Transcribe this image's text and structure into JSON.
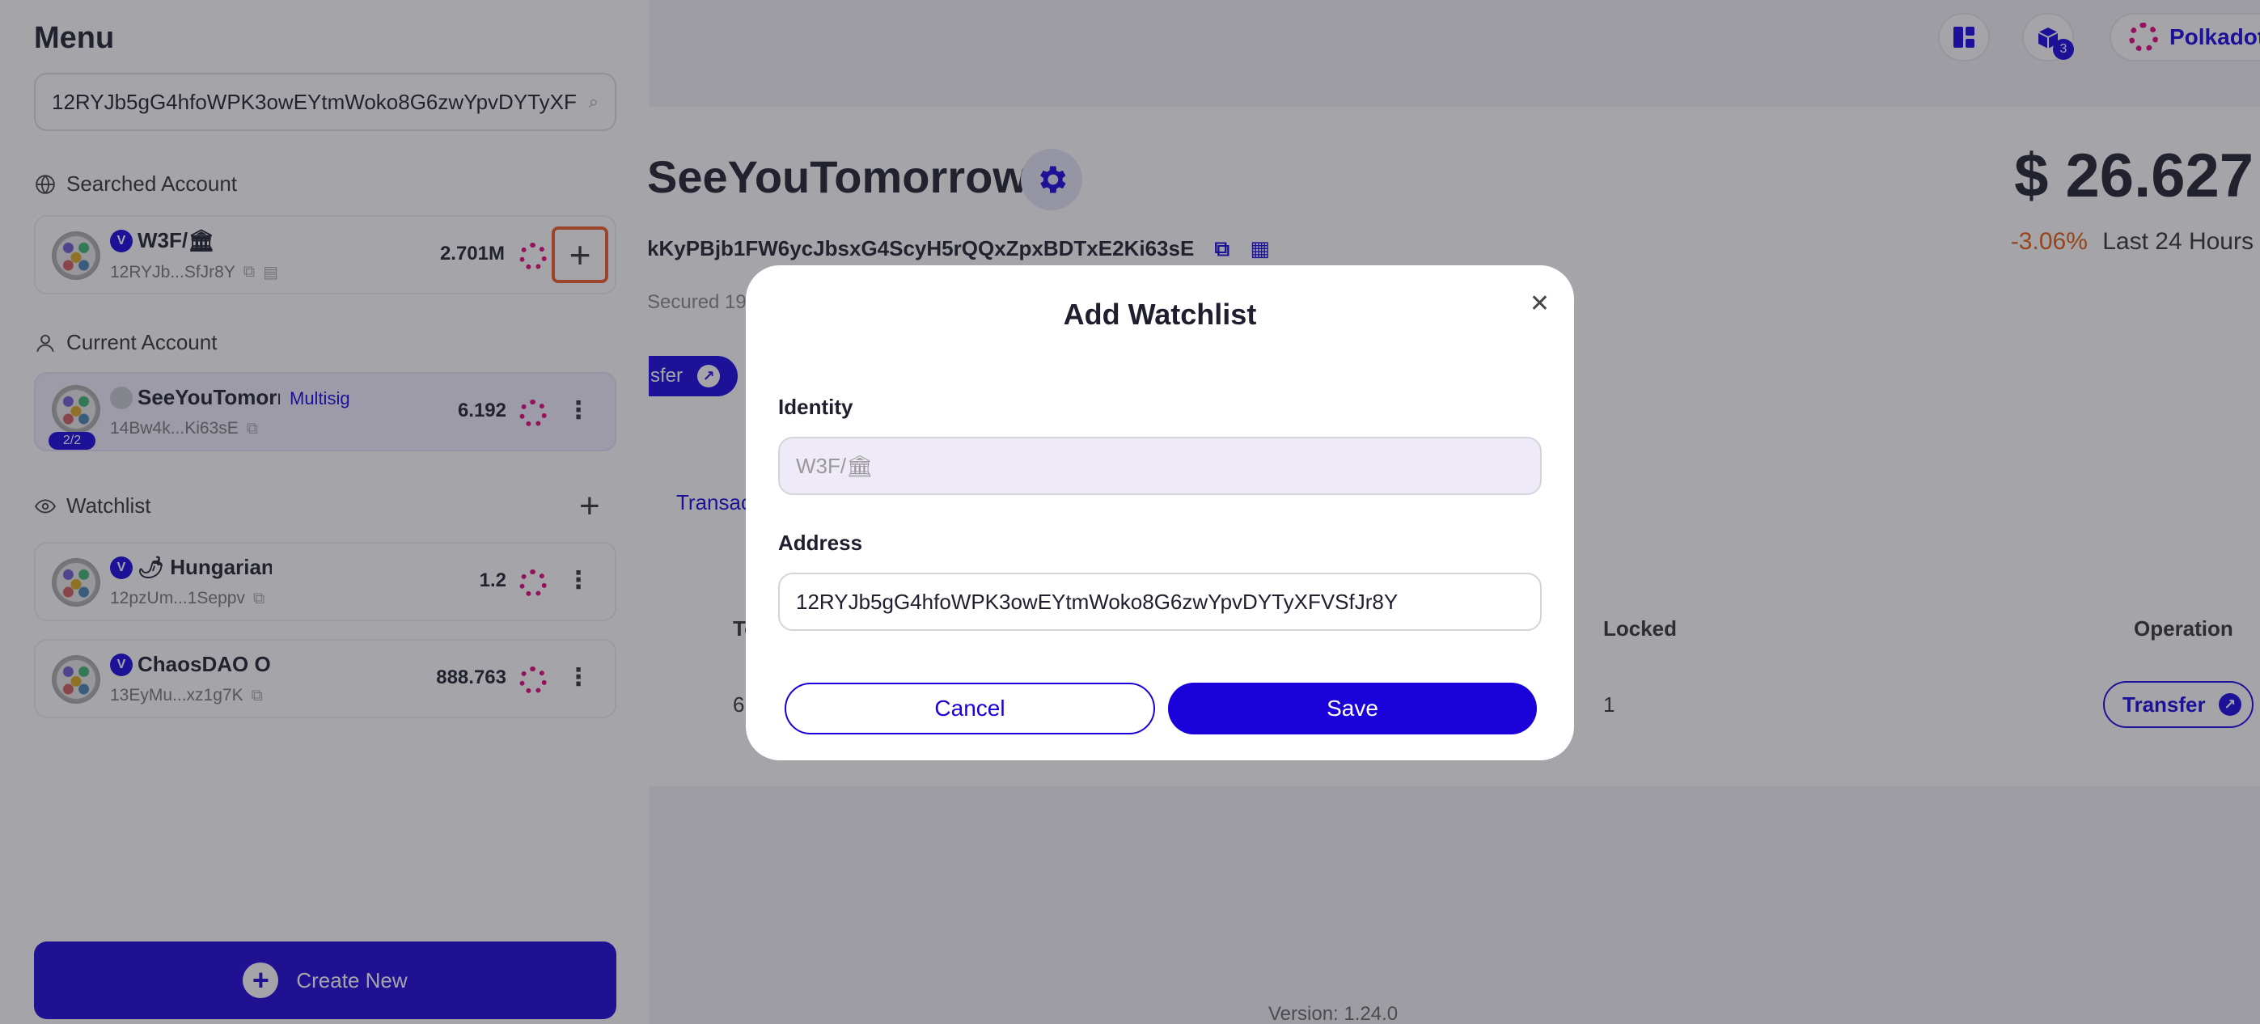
{
  "topbar": {
    "network_label": "Polkadot",
    "notifications_count": "3"
  },
  "account": {
    "name": "SeeYouTomorrow",
    "address": "kKyPBjb1FW6ycJbsxG4ScyH5rQQxZpxBDTxE2Ki63sE",
    "secured": "Secured 19",
    "transfer_label": "sfer",
    "usd_value": "$ 26.627",
    "change_percent": "-3.06%",
    "change_period": "Last 24 Hours",
    "tab_partial": "Transac"
  },
  "table": {
    "headers": {
      "col1": "To",
      "locked": "Locked",
      "operation": "Operation"
    },
    "row": {
      "col1": "6",
      "locked": "1",
      "operation_label": "Transfer"
    }
  },
  "version": "Version: 1.24.0",
  "sidebar": {
    "title": "Menu",
    "search_value": "12RYJb5gG4hfoWPK3owEYtmWoko8G6zwYpvDYTyXF",
    "searched_label": "Searched Account",
    "searched": {
      "name": "W3F/🏛",
      "address": "12RYJb...SfJr8Y",
      "balance": "2.701M"
    },
    "current_label": "Current Account",
    "current": {
      "name": "SeeYouTomorr",
      "tag": "Multisig",
      "threshold": "2/2",
      "address": "14Bw4k...Ki63sE",
      "balance": "6.192"
    },
    "watchlist_label": "Watchlist",
    "watchlist": [
      {
        "name": "🌶 Hungarian F",
        "address": "12pzUm...1Seppv",
        "balance": "1.2"
      },
      {
        "name": "ChaosDAO Ope",
        "address": "13EyMu...xz1g7K",
        "balance": "888.763"
      }
    ],
    "create_new": "Create New"
  },
  "modal": {
    "title": "Add Watchlist",
    "identity_label": "Identity",
    "identity_value": "W3F/🏛",
    "address_label": "Address",
    "address_value": "12RYJb5gG4hfoWPK3owEYtmWoko8G6zwYpvDYTyXFVSfJr8Y",
    "cancel_label": "Cancel",
    "save_label": "Save"
  },
  "colors": {
    "brand": "#1a00d9",
    "polkadot": "#e6007a",
    "highlight": "#f05a28",
    "negative": "#e8590c"
  }
}
